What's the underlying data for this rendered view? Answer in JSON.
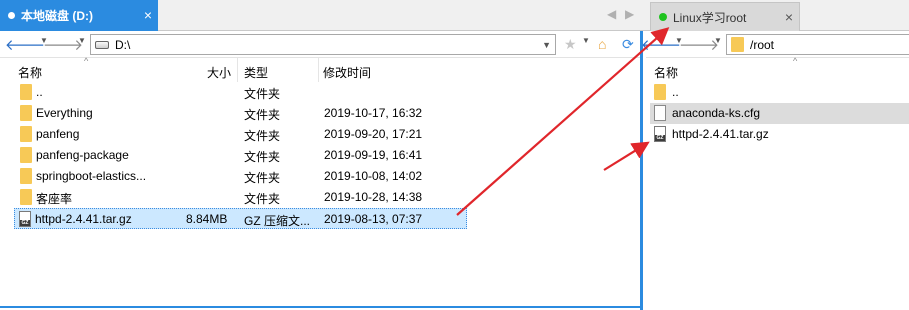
{
  "left": {
    "tab_label": "本地磁盘 (D:)",
    "tab_close": "×",
    "tab_nav_prev": "◀",
    "tab_nav_next": "▶",
    "path": "D:\\",
    "columns": {
      "name": "名称",
      "size": "大小",
      "type": "类型",
      "modified": "修改时间"
    },
    "files": [
      {
        "name": "..",
        "size": "",
        "type": "文件夹",
        "modified": "",
        "icon": "folder"
      },
      {
        "name": "Everything",
        "size": "",
        "type": "文件夹",
        "modified": "2019-10-17, 16:32",
        "icon": "folder"
      },
      {
        "name": "panfeng",
        "size": "",
        "type": "文件夹",
        "modified": "2019-09-20, 17:21",
        "icon": "folder"
      },
      {
        "name": "panfeng-package",
        "size": "",
        "type": "文件夹",
        "modified": "2019-09-19, 16:41",
        "icon": "folder"
      },
      {
        "name": "springboot-elastics...",
        "size": "",
        "type": "文件夹",
        "modified": "2019-10-08, 14:02",
        "icon": "folder"
      },
      {
        "name": "客座率",
        "size": "",
        "type": "文件夹",
        "modified": "2019-10-28, 14:38",
        "icon": "folder"
      },
      {
        "name": "httpd-2.4.41.tar.gz",
        "size": "8.84MB",
        "type": "GZ 压缩文...",
        "modified": "2019-08-13, 07:37",
        "icon": "gz-archive"
      }
    ]
  },
  "right": {
    "tab_label": "Linux学习root",
    "tab_close": "×",
    "path": "/root",
    "columns": {
      "name": "名称"
    },
    "files": [
      {
        "name": "..",
        "icon": "folder"
      },
      {
        "name": "anaconda-ks.cfg",
        "icon": "document"
      },
      {
        "name": "httpd-2.4.41.tar.gz",
        "icon": "gz-archive"
      }
    ]
  },
  "colors": {
    "accent": "#2b8be0",
    "selection": "#cce8ff",
    "connected": "#1ec31e",
    "annotation_arrow": "#e0262b"
  }
}
